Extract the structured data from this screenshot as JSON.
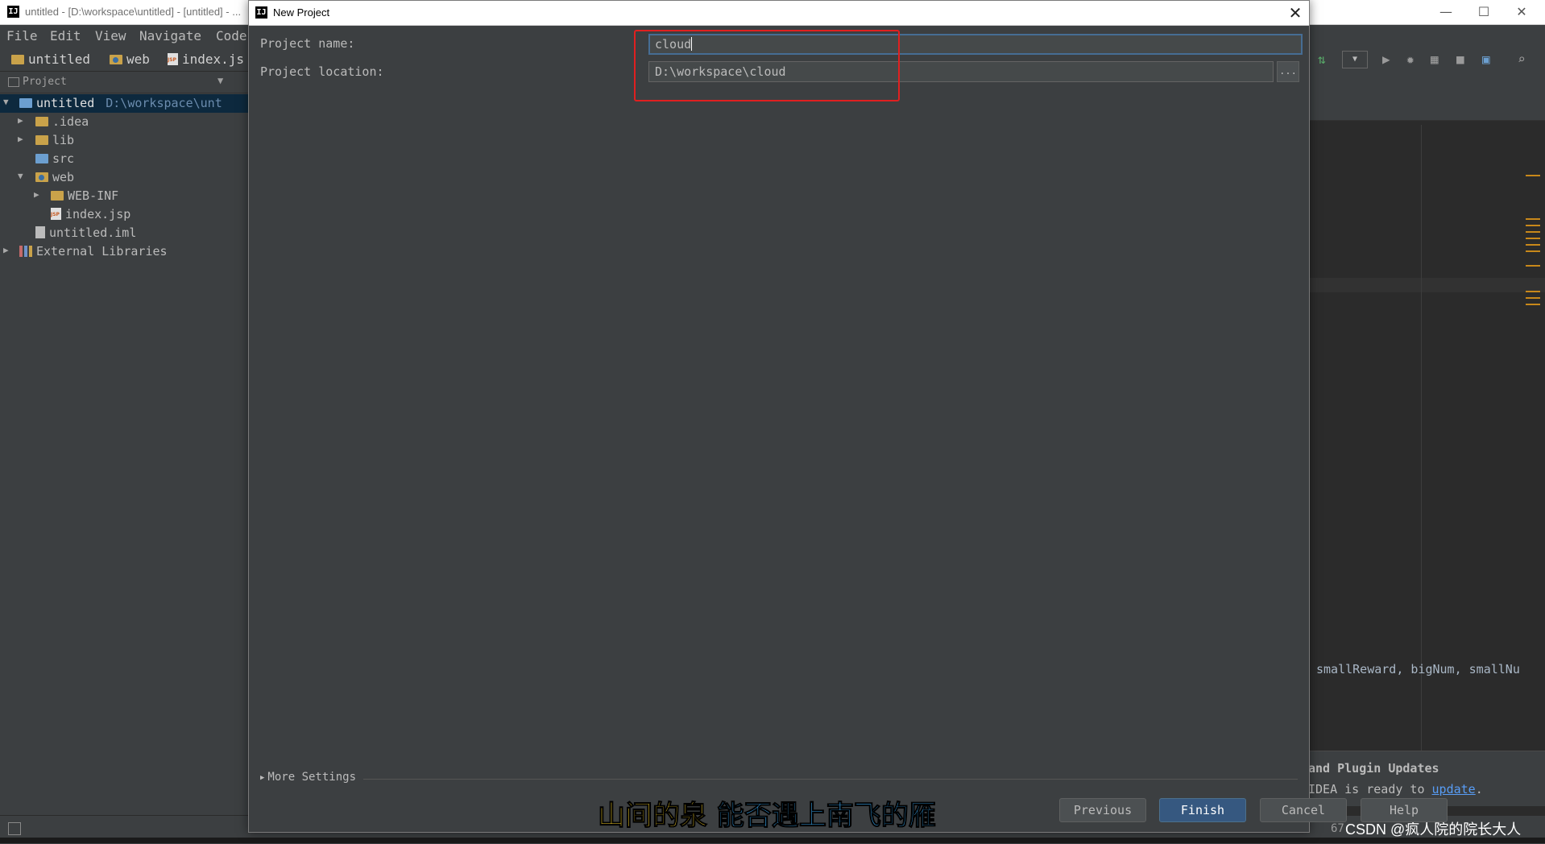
{
  "ide_window": {
    "title": "untitled - [D:\\workspace\\untitled] - [untitled] - ...",
    "logo": "IJ",
    "controls": {
      "minimize": "—",
      "maximize": "☐",
      "close": "✕"
    }
  },
  "menu": {
    "items": [
      {
        "label": "File"
      },
      {
        "label": "Edit"
      },
      {
        "label": "View"
      },
      {
        "label": "Navigate"
      },
      {
        "label": "Code"
      }
    ]
  },
  "breadcrumb": {
    "items": [
      {
        "label": "untitled",
        "icon": "folder-icon"
      },
      {
        "label": "web",
        "icon": "web-folder-icon"
      },
      {
        "label": "index.js",
        "icon": "jsp-file-icon"
      }
    ]
  },
  "project_panel": {
    "header": "Project",
    "tree": [
      {
        "label": "untitled",
        "path": "D:\\workspace\\unt",
        "expanded": true,
        "level": 0,
        "icon": "module-folder-icon"
      },
      {
        "label": ".idea",
        "level": 1,
        "icon": "folder-icon"
      },
      {
        "label": "lib",
        "level": 1,
        "icon": "folder-icon"
      },
      {
        "label": "src",
        "level": 1,
        "icon": "source-folder-icon"
      },
      {
        "label": "web",
        "level": 1,
        "expanded": true,
        "icon": "web-folder-icon"
      },
      {
        "label": "WEB-INF",
        "level": 2,
        "icon": "folder-icon"
      },
      {
        "label": "index.jsp",
        "level": 2,
        "icon": "jsp-file-icon"
      },
      {
        "label": "untitled.iml",
        "level": 1,
        "icon": "iml-file-icon"
      },
      {
        "label": "External Libraries",
        "level": 0,
        "icon": "library-icon"
      }
    ]
  },
  "editor": {
    "code_fragment": "smallReward, bigNum, smallNu"
  },
  "notification": {
    "line1": "and Plugin Updates",
    "line2_prefix": "IDEA is ready to ",
    "link": "update",
    "line2_suffix": "."
  },
  "statusbar": {
    "position": "67"
  },
  "watermark": "CSDN @疯人院的院长大人",
  "dialog": {
    "title": "New Project",
    "logo": "IJ",
    "close": "✕",
    "project_name_label": "Project name:",
    "project_name_value": "cloud",
    "project_location_label": "Project location:",
    "project_location_value": "D:\\workspace\\cloud",
    "browse_label": "...",
    "more_settings": "More Settings",
    "buttons": {
      "previous": "Previous",
      "finish": "Finish",
      "cancel": "Cancel",
      "help": "Help"
    }
  },
  "subtitle": {
    "part1": "山间的泉",
    "part2": "能否遇上南飞的雁"
  },
  "colors": {
    "background": "#3c3f41",
    "primary_button": "#365880",
    "highlight": "#e02020",
    "selection": "#0d293e"
  }
}
